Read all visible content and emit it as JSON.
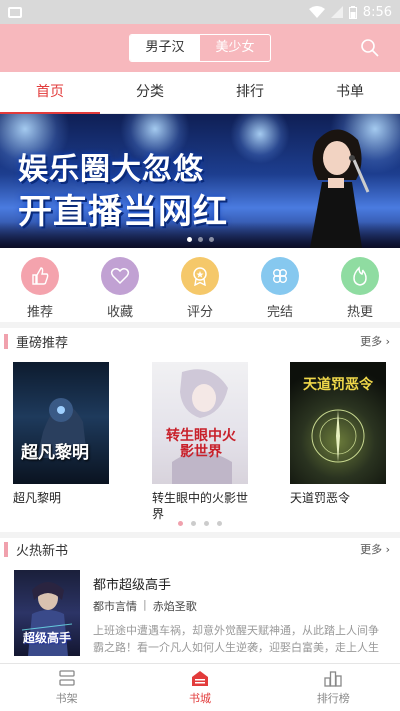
{
  "status": {
    "time": "8:56"
  },
  "header": {
    "segments": [
      {
        "label": "男子汉",
        "selected": true
      },
      {
        "label": "美少女",
        "selected": false
      }
    ],
    "search_icon": "search-icon"
  },
  "tabs": [
    {
      "label": "首页",
      "active": true
    },
    {
      "label": "分类"
    },
    {
      "label": "排行"
    },
    {
      "label": "书单"
    }
  ],
  "banner": {
    "line1": "娱乐圈大忽悠",
    "line2": "开直播当网红",
    "page": 1,
    "total": 3
  },
  "quick": [
    {
      "label": "推荐",
      "icon": "thumbs-up-icon",
      "color": "#f4a3ad"
    },
    {
      "label": "收藏",
      "icon": "heart-icon",
      "color": "#c1a1d3"
    },
    {
      "label": "评分",
      "icon": "rating-badge-icon",
      "color": "#f5c86a"
    },
    {
      "label": "完结",
      "icon": "clover-icon",
      "color": "#86c8ef"
    },
    {
      "label": "热更",
      "icon": "flame-icon",
      "color": "#8fdca1"
    }
  ],
  "hot_recommend": {
    "title": "重磅推荐",
    "more": "更多",
    "books": [
      {
        "name": "超凡黎明",
        "cover_text": "超凡黎明"
      },
      {
        "name": "转生眼中的火影世界",
        "cover_text": "转生眼中火影世界"
      },
      {
        "name": "天道罚恶令",
        "cover_text": "天道罚恶令"
      }
    ],
    "page": 1,
    "total": 4
  },
  "new_books": {
    "title": "火热新书",
    "more": "更多",
    "item": {
      "title": "都市超级高手",
      "category": "都市言情",
      "separator": "|",
      "author": "赤焰圣歌",
      "description": "上班途中遭遇车祸，却意外觉醒天赋神通，从此踏上人间争霸之路！看一介凡人如何人生逆袭，迎娶白富美，走上人生巅...",
      "cover_text": "超级高手"
    }
  },
  "bottom_nav": [
    {
      "label": "书架",
      "icon": "bookshelf-icon",
      "active": false
    },
    {
      "label": "书城",
      "icon": "bookstore-icon",
      "active": true
    },
    {
      "label": "排行榜",
      "icon": "ranking-icon",
      "active": false
    }
  ],
  "colors": {
    "accent": "#e23b3b",
    "header_bg": "#f7b8bd",
    "section_bar": "#f0a1ad"
  }
}
